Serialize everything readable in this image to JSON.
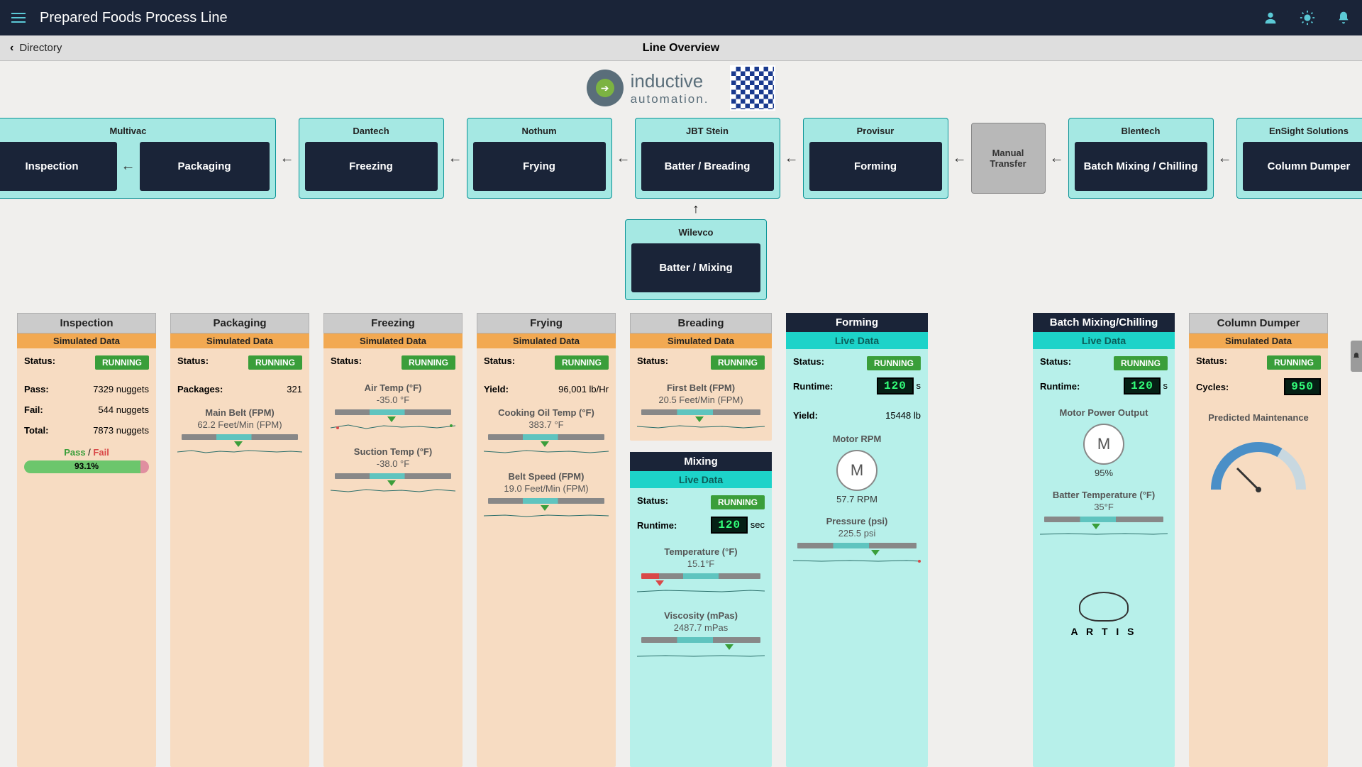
{
  "header": {
    "app_title": "Prepared Foods Process Line"
  },
  "breadcrumb": {
    "back_label": "Directory",
    "page_title": "Line Overview"
  },
  "logo": {
    "line1": "inductive",
    "line2": "automation."
  },
  "flow": {
    "multivac": {
      "vendor": "Multivac",
      "step1": "Inspection",
      "step2": "Packaging"
    },
    "dantech": {
      "vendor": "Dantech",
      "step": "Freezing"
    },
    "nothum": {
      "vendor": "Nothum",
      "step": "Frying"
    },
    "jbt": {
      "vendor": "JBT Stein",
      "step": "Batter / Breading"
    },
    "provisur": {
      "vendor": "Provisur",
      "step": "Forming"
    },
    "manual": {
      "step": "Manual\nTransfer"
    },
    "blentech": {
      "vendor": "Blentech",
      "step": "Batch Mixing / Chilling"
    },
    "ensight": {
      "vendor": "EnSight Solutions",
      "step": "Column Dumper"
    },
    "wilevco": {
      "vendor": "Wilevco",
      "step": "Batter / Mixing"
    }
  },
  "labels": {
    "status": "Status:",
    "running": "RUNNING",
    "simulated": "Simulated Data",
    "live": "Live Data",
    "runtime": "Runtime:",
    "yield": "Yield:",
    "sec": "sec",
    "s": "s"
  },
  "inspection": {
    "title": "Inspection",
    "pass_lbl": "Pass:",
    "pass_val": "7329 nuggets",
    "fail_lbl": "Fail:",
    "fail_val": "544 nuggets",
    "total_lbl": "Total:",
    "total_val": "7873 nuggets",
    "pf_label_pass": "Pass",
    "pf_label_fail": "Fail",
    "pct": "93.1%"
  },
  "packaging": {
    "title": "Packaging",
    "pkg_lbl": "Packages:",
    "pkg_val": "321",
    "belt_title": "Main Belt (FPM)",
    "belt_val": "62.2 Feet/Min (FPM)"
  },
  "freezing": {
    "title": "Freezing",
    "air_title": "Air Temp (°F)",
    "air_val": "-35.0 °F",
    "suction_title": "Suction Temp (°F)",
    "suction_val": "-38.0 °F"
  },
  "frying": {
    "title": "Frying",
    "yield_val": "96,001 lb/Hr",
    "oil_title": "Cooking Oil Temp (°F)",
    "oil_val": "383.7 °F",
    "belt_title": "Belt Speed (FPM)",
    "belt_val": "19.0 Feet/Min (FPM)"
  },
  "breading": {
    "title": "Breading",
    "belt_title": "First Belt (FPM)",
    "belt_val": "20.5 Feet/Min (FPM)"
  },
  "mixing": {
    "title": "Mixing",
    "runtime_val": "120",
    "temp_title": "Temperature (°F)",
    "temp_val": "15.1°F",
    "visc_title": "Viscosity (mPas)",
    "visc_val": "2487.7 mPas"
  },
  "forming": {
    "title": "Forming",
    "runtime_val": "120",
    "yield_val": "15448 lb",
    "rpm_title": "Motor RPM",
    "rpm_val": "57.7 RPM",
    "motor": "M",
    "press_title": "Pressure (psi)",
    "press_val": "225.5 psi"
  },
  "batchmix": {
    "title": "Batch Mixing/Chilling",
    "runtime_val": "120",
    "power_title": "Motor Power Output",
    "motor": "M",
    "power_val": "95%",
    "temp_title": "Batter Temperature (°F)",
    "temp_val": "35°F",
    "artis": "A R T I S"
  },
  "dumper": {
    "title": "Column Dumper",
    "cycles_lbl": "Cycles:",
    "cycles_val": "950",
    "maint_title": "Predicted Maintenance"
  }
}
